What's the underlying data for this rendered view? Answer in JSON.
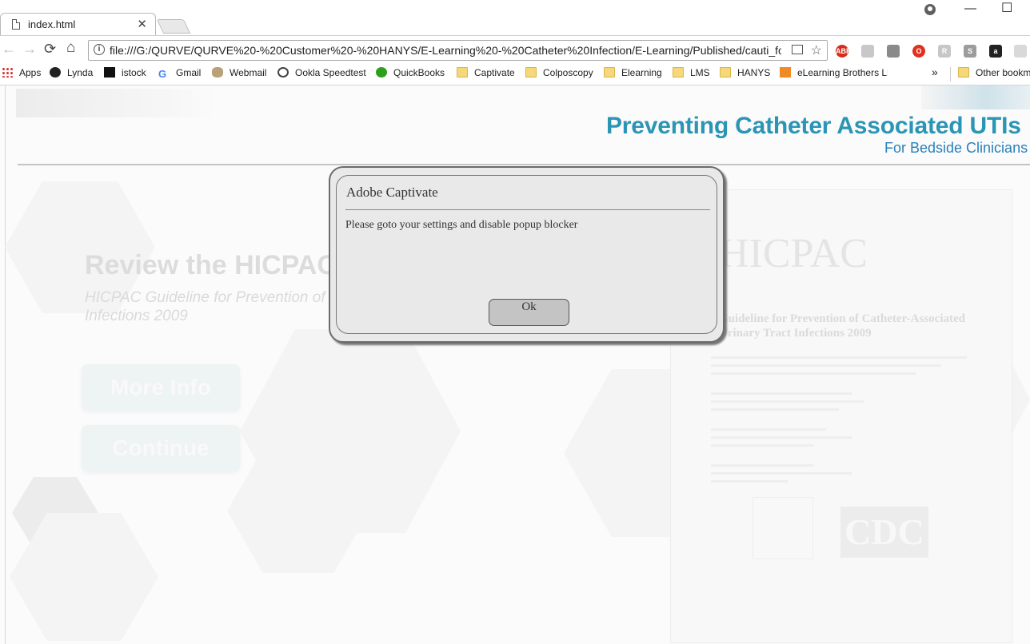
{
  "browser": {
    "tab_title": "index.html",
    "tab_close": "✕",
    "url": "file:///G:/QURVE/QURVE%20-%20Customer%20-%20HANYS/E-Learning%20-%20Catheter%20Infection/E-Learning/Published/cauti_for...",
    "bookmarks": [
      {
        "label": "Apps",
        "icon": "apps-grid-icon"
      },
      {
        "label": "Lynda",
        "icon": "lynda-icon"
      },
      {
        "label": "istock",
        "icon": "istock-icon"
      },
      {
        "label": "Gmail",
        "icon": "google-icon"
      },
      {
        "label": "Webmail",
        "icon": "webmail-icon"
      },
      {
        "label": "Ookla Speedtest",
        "icon": "speedometer-icon"
      },
      {
        "label": "QuickBooks",
        "icon": "quickbooks-icon"
      },
      {
        "label": "Captivate",
        "icon": "folder-icon"
      },
      {
        "label": "Colposcopy",
        "icon": "folder-icon"
      },
      {
        "label": "Elearning",
        "icon": "folder-icon"
      },
      {
        "label": "LMS",
        "icon": "folder-icon"
      },
      {
        "label": "HANYS",
        "icon": "folder-icon"
      },
      {
        "label": "eLearning Brothers Li",
        "icon": "elearning-brothers-icon"
      }
    ],
    "bookmarks_overflow": "»",
    "other_bookmarks": "Other bookm"
  },
  "page": {
    "course_title": "Preventing Catheter Associated UTIs",
    "course_subtitle": "For Bedside Clinicians",
    "review_title": "Review the HICPAC",
    "review_subtitle": "HICPAC Guideline for Prevention of Infections 2009",
    "more_info_button": "More Info",
    "continue_button": "Continue",
    "doc_org": "HICPAC",
    "doc_title": "Guideline for Prevention of Catheter-Associated Urinary Tract Infections 2009",
    "doc_logo": "CDC"
  },
  "dialog": {
    "title": "Adobe Captivate",
    "message": "Please goto your settings and disable popup blocker",
    "ok_label": "Ok"
  },
  "colors": {
    "course_title": "#2b95b5",
    "dialog_bg": "#e9e9e9",
    "ok_button": "#c4c4c4"
  }
}
